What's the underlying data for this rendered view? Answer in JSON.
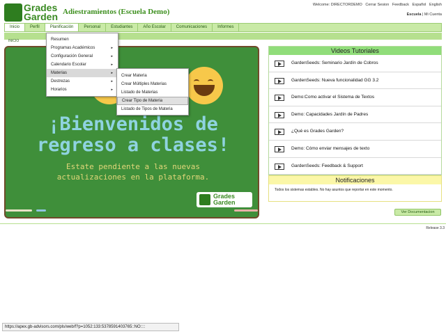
{
  "logo": {
    "line1": "Grades",
    "line2": "Garden"
  },
  "header": {
    "title": "Adiestramientos (Escuela Demo)"
  },
  "top_links": {
    "welcome": "Welcome: DIRECTORDEMO",
    "logout": "Cerrar Sesion",
    "feedback": "Feedback",
    "spanish": "Español",
    "english": "English"
  },
  "school_links": {
    "school": "Escuela",
    "separator": "|",
    "account": "Mi Cuenta"
  },
  "nav": {
    "items": [
      "Inicio",
      "Perfil",
      "Planificación",
      "Personal",
      "Estudiantes",
      "Año Escolar",
      "Comunicaciones",
      "Informes"
    ]
  },
  "subbar": {
    "label": "INICIO"
  },
  "menu_planificacion": {
    "items": [
      "Resumen",
      "Programas Académicos",
      "Configuración General",
      "Calendario Escolar",
      "Materias",
      "Destrezas",
      "Horarios"
    ],
    "arrow": "▸"
  },
  "menu_materias": {
    "items": [
      "Crear Materia",
      "Crear Múltiples Materias",
      "Listado de Materias",
      "Crear Tipo de Materia",
      "Listado de Tipos de Materia"
    ]
  },
  "banner": {
    "title_line1": "¡Bienvenidos de",
    "title_line2": "regreso a clases!",
    "sub_line1": "Estate pendiente a las nuevas",
    "sub_line2": "actualizaciones en la plataforma.",
    "logo_line1": "Grades",
    "logo_line2": "Garden",
    "colors": {
      "board": "#3f8f3a",
      "frame": "#6f4a2a",
      "title": "#8fd3e0",
      "subtitle": "#e3d77a",
      "emoji": "#f7c84a"
    }
  },
  "videos": {
    "title": "Videos Tutoriales",
    "items": [
      "GardenSeeds: Seminario Jardín de Cobros",
      "GardenSeeds: Nueva funcionalidad GG 3.2",
      "Demo:Como activar el Sistema de Textos",
      "Demo: Capacidades Jardín de Padres",
      "¿Qué es Grades Garden?",
      "Demo: Cómo enviar mensajes de texto",
      "GardenSeeds: Feedback & Support"
    ]
  },
  "notifications": {
    "title": "Notificaciones",
    "message": "Todos los sistemas estables. No hay asuntos que reportar en este momento."
  },
  "doc_button": "Ver Documentacion",
  "release": "Release 3.3",
  "statusbar": "https://apex.gb-advisors.com/pls/web/f?p=1052:133:5378591403765::NO::::",
  "colors": {
    "accent": "#3d8f1e",
    "nav_bg": "#c9eaa6",
    "video_header": "#90dd7a",
    "notif_header": "#fbf7a8"
  }
}
